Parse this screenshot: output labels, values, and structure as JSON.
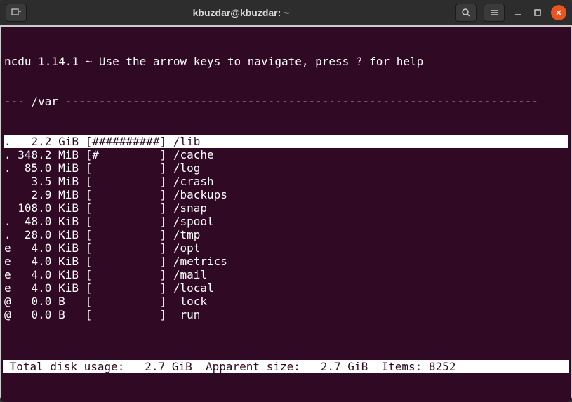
{
  "titlebar": {
    "title": "kbuzdar@kbuzdar: ~"
  },
  "header": {
    "line": "ncdu 1.14.1 ~ Use the arrow keys to navigate, press ? for help"
  },
  "path_line": "--- /var ----------------------------------------------------------------------",
  "rows": [
    {
      "prefix": ".",
      "size": "2.2",
      "unit": "GiB",
      "bar": "##########",
      "name": "/lib",
      "selected": true
    },
    {
      "prefix": ".",
      "size": "348.2",
      "unit": "MiB",
      "bar": "#         ",
      "name": "/cache"
    },
    {
      "prefix": ".",
      "size": "85.0",
      "unit": "MiB",
      "bar": "          ",
      "name": "/log"
    },
    {
      "prefix": " ",
      "size": "3.5",
      "unit": "MiB",
      "bar": "          ",
      "name": "/crash"
    },
    {
      "prefix": " ",
      "size": "2.9",
      "unit": "MiB",
      "bar": "          ",
      "name": "/backups"
    },
    {
      "prefix": " ",
      "size": "108.0",
      "unit": "KiB",
      "bar": "          ",
      "name": "/snap"
    },
    {
      "prefix": ".",
      "size": "48.0",
      "unit": "KiB",
      "bar": "          ",
      "name": "/spool"
    },
    {
      "prefix": ".",
      "size": "28.0",
      "unit": "KiB",
      "bar": "          ",
      "name": "/tmp"
    },
    {
      "prefix": "e",
      "size": "4.0",
      "unit": "KiB",
      "bar": "          ",
      "name": "/opt"
    },
    {
      "prefix": "e",
      "size": "4.0",
      "unit": "KiB",
      "bar": "          ",
      "name": "/metrics"
    },
    {
      "prefix": "e",
      "size": "4.0",
      "unit": "KiB",
      "bar": "          ",
      "name": "/mail"
    },
    {
      "prefix": "e",
      "size": "4.0",
      "unit": "KiB",
      "bar": "          ",
      "name": "/local"
    },
    {
      "prefix": "@",
      "size": "0.0",
      "unit": "B",
      "bar": "          ",
      "name": " lock"
    },
    {
      "prefix": "@",
      "size": "0.0",
      "unit": "B",
      "bar": "          ",
      "name": " run"
    }
  ],
  "footer": {
    "total_label": " Total disk usage:",
    "total_value": "2.7 GiB",
    "apparent_label": "Apparent size:",
    "apparent_value": "2.7 GiB",
    "items_label": "Items:",
    "items_value": "8252"
  }
}
